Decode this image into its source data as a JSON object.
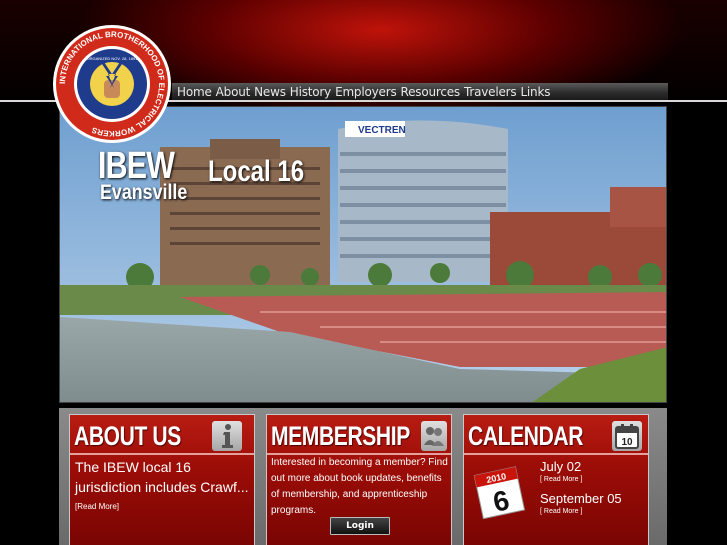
{
  "brand": {
    "logo_ring_text": "INTERNATIONAL BROTHERHOOD OF ELECTRICAL WORKERS",
    "logo_center_text": "ORGANIZED NOV. 28, 1891",
    "logo_icon": "fist-with-lightning-icon",
    "accent_color": "#c8140a"
  },
  "nav": {
    "items": [
      "Home",
      "About",
      "News",
      "History",
      "Employers",
      "Resources",
      "Travelers",
      "Links"
    ]
  },
  "hero": {
    "title_main": "IBEW",
    "title_local": "Local 16",
    "title_city": "Evansville",
    "building_sign": "VECTREN"
  },
  "cards": {
    "about": {
      "title": "ABOUT US",
      "icon": "info-icon",
      "text": "The IBEW local 16 jurisdiction includes Crawf...",
      "read_more": "[Read More]"
    },
    "membership": {
      "title": "MEMBERSHIP",
      "icon": "members-icon",
      "text": "Interested in becoming a member? Find out more about book updates, benefits of membership, and apprenticeship programs.",
      "login": "Login"
    },
    "calendar": {
      "title": "CALENDAR",
      "icon": "calendar-icon",
      "icon_day": "10",
      "page_year": "2010",
      "page_day": "6",
      "events": [
        {
          "date": "July 02",
          "read_more": "[ Read More ]"
        },
        {
          "date": "September 05",
          "read_more": "[ Read More ]"
        }
      ]
    }
  }
}
